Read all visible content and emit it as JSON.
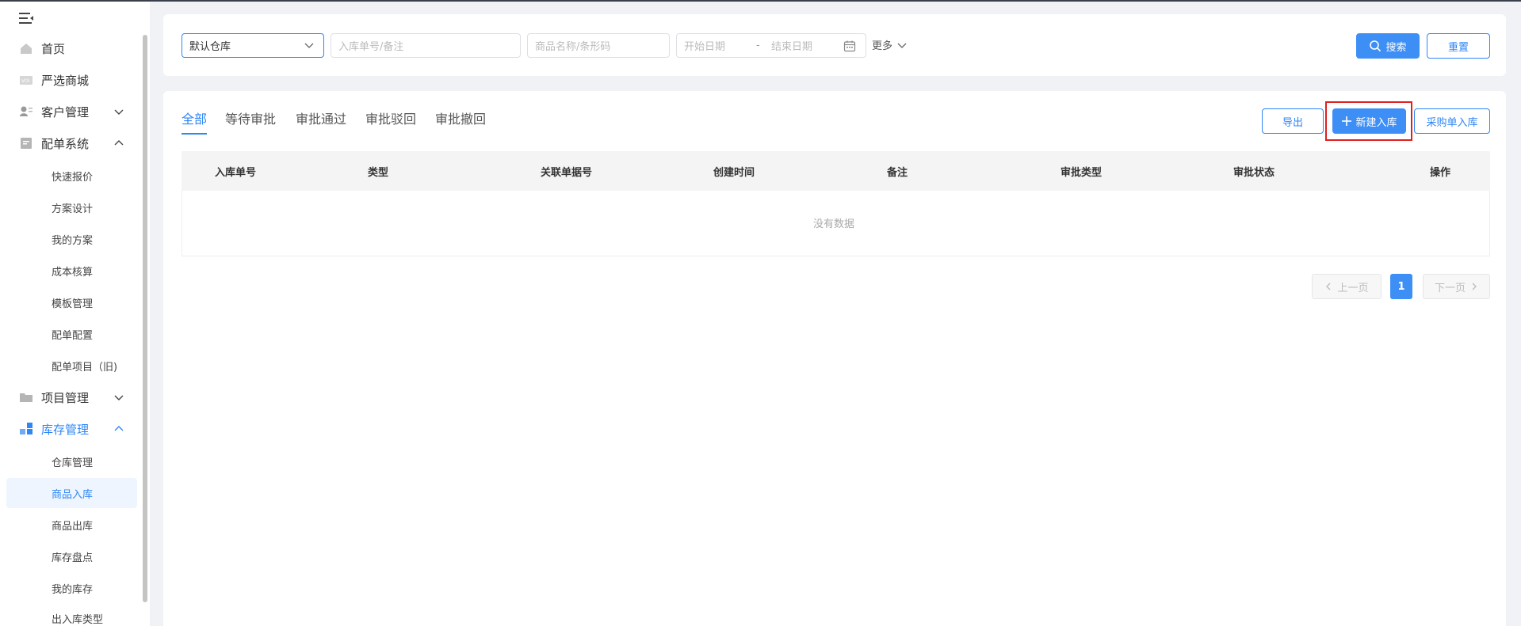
{
  "sidebar": {
    "items": [
      {
        "label": "首页",
        "icon": "home-icon"
      },
      {
        "label": "严选商城",
        "icon": "mall-icon"
      },
      {
        "label": "客户管理",
        "icon": "customer-icon"
      },
      {
        "label": "配单系统",
        "icon": "document-icon"
      },
      {
        "label": "项目管理",
        "icon": "folder-icon"
      },
      {
        "label": "库存管理",
        "icon": "inventory-icon"
      }
    ],
    "peidan_sub": [
      "快速报价",
      "方案设计",
      "我的方案",
      "成本核算",
      "模板管理",
      "配单配置",
      "配单项目（旧)"
    ],
    "kucun_sub": [
      "仓库管理",
      "商品入库",
      "商品出库",
      "库存盘点",
      "我的库存",
      "出入库类型"
    ]
  },
  "filters": {
    "warehouse": "默认仓库",
    "order_placeholder": "入库单号/备注",
    "goods_placeholder": "商品名称/条形码",
    "start_date": "开始日期",
    "date_sep": "-",
    "end_date": "结束日期",
    "more": "更多",
    "search": "搜索",
    "reset": "重置"
  },
  "tabs": [
    "全部",
    "等待审批",
    "审批通过",
    "审批驳回",
    "审批撤回"
  ],
  "actions": {
    "export": "导出",
    "new": "新建入库",
    "purchase": "采购单入库"
  },
  "table": {
    "columns": [
      "入库单号",
      "类型",
      "关联单据号",
      "创建时间",
      "备注",
      "审批类型",
      "审批状态",
      "操作"
    ],
    "empty": "没有数据"
  },
  "pagination": {
    "prev": "上一页",
    "page": "1",
    "next": "下一页"
  },
  "colors": {
    "accent": "#2f86f6",
    "highlight": "#e02020"
  }
}
